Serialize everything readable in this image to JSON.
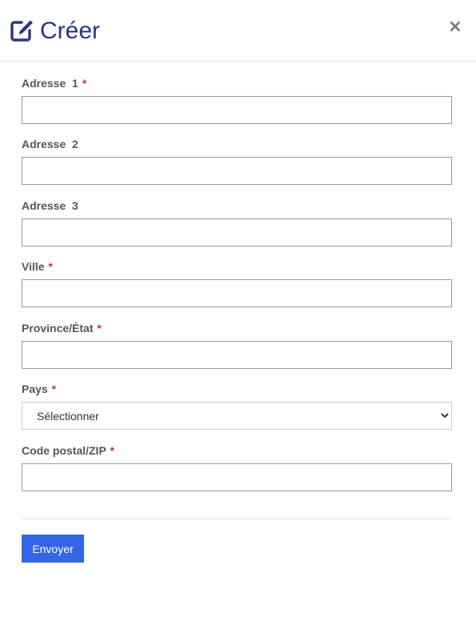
{
  "dialog": {
    "title": "Créer",
    "title_icon": "edit-square-icon",
    "close_label": "×",
    "accent_color": "#2a3480"
  },
  "fields": {
    "address1": {
      "label": "Adresse  1",
      "required": "*",
      "value": ""
    },
    "address2": {
      "label": "Adresse  2",
      "value": ""
    },
    "address3": {
      "label": "Adresse  3",
      "value": ""
    },
    "city": {
      "label": "Ville",
      "required": "*",
      "value": ""
    },
    "province": {
      "label": "Province/État",
      "required": "*",
      "value": ""
    },
    "country": {
      "label": "Pays",
      "required": "*",
      "selected": "Sélectionner"
    },
    "postal": {
      "label": "Code postal/ZIP",
      "required": "*",
      "value": ""
    }
  },
  "actions": {
    "submit_label": "Envoyer",
    "submit_color": "#3366e6"
  }
}
